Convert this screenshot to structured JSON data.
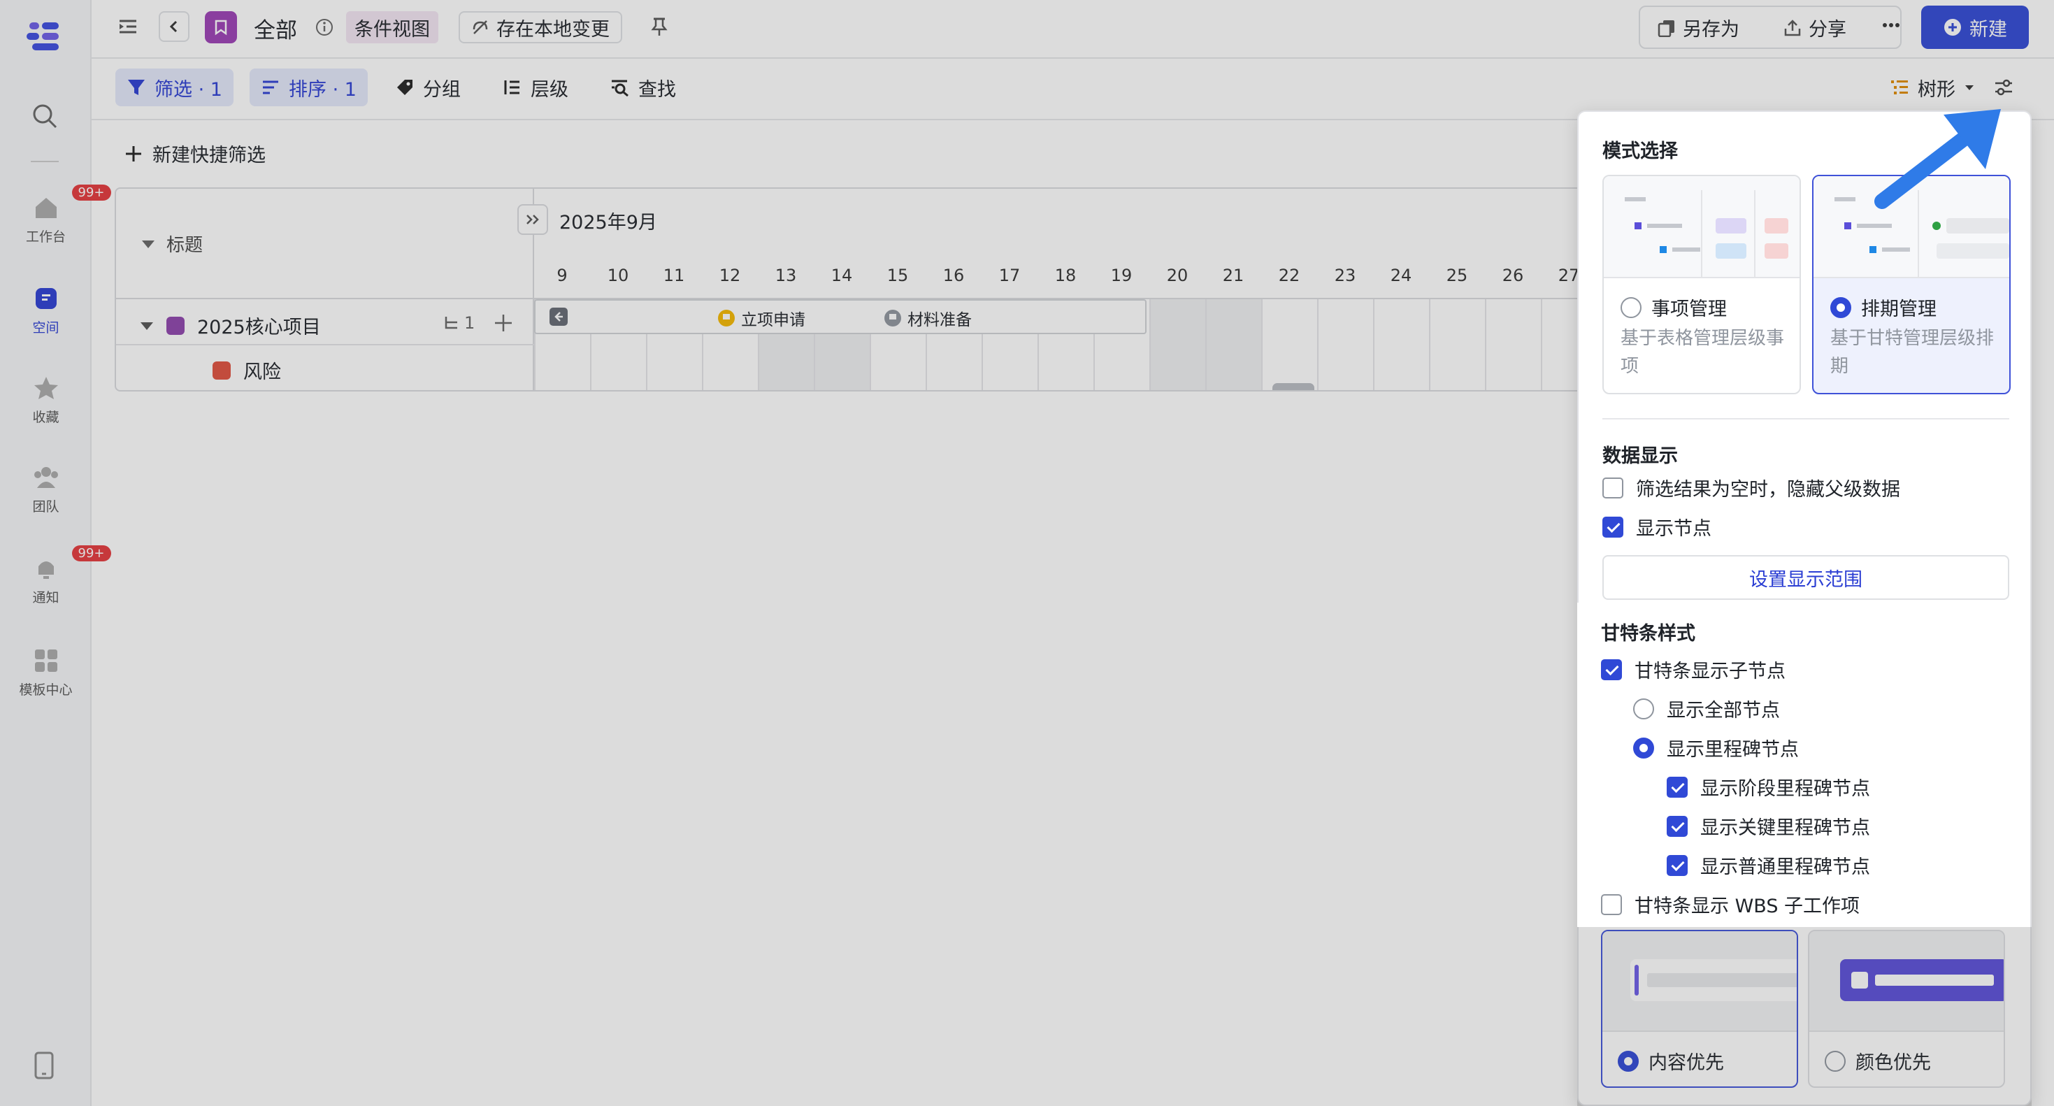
{
  "sidebar": {
    "items": [
      {
        "label": "工作台",
        "icon": "home-icon",
        "badge": "99+"
      },
      {
        "label": "空间",
        "icon": "space-icon",
        "active": true
      },
      {
        "label": "收藏",
        "icon": "star-icon"
      },
      {
        "label": "团队",
        "icon": "team-icon"
      },
      {
        "label": "通知",
        "icon": "bell-icon",
        "badge": "99+"
      },
      {
        "label": "模板中心",
        "icon": "template-icon"
      }
    ]
  },
  "topbar": {
    "title": "全部",
    "view_tag": "条件视图",
    "save_local": "存在本地变更",
    "save_as": "另存为",
    "share": "分享",
    "new_button": "新建"
  },
  "toolbar": {
    "filter": "筛选 · 1",
    "sort": "排序 · 1",
    "group": "分组",
    "level": "层级",
    "find": "查找",
    "view_mode": "树形"
  },
  "quick_filter": "新建快捷筛选",
  "gantt": {
    "title_header": "标题",
    "month": "2025年9月",
    "days": [
      "9",
      "10",
      "11",
      "12",
      "13",
      "14",
      "15",
      "16",
      "17",
      "18",
      "19",
      "20",
      "21",
      "22",
      "23",
      "24",
      "25",
      "26",
      "27"
    ],
    "rows": [
      {
        "name": "2025核心项目",
        "color": "#8e44ad",
        "children_count": "1"
      },
      {
        "name": "风险",
        "color": "#e0503d"
      }
    ],
    "milestones": [
      "立项申请",
      "材料准备"
    ]
  },
  "panel": {
    "mode_title": "模式选择",
    "modes": [
      {
        "title": "事项管理",
        "desc": "基于表格管理层级事项",
        "selected": false
      },
      {
        "title": "排期管理",
        "desc": "基于甘特管理层级排期",
        "selected": true
      }
    ],
    "data_title": "数据显示",
    "hide_parent": "筛选结果为空时，隐藏父级数据",
    "show_nodes": "显示节点",
    "set_range": "设置显示范围",
    "gantt_style_title": "甘特条样式",
    "show_child_nodes": "甘特条显示子节点",
    "show_all_nodes": "显示全部节点",
    "show_milestone_nodes": "显示里程碑节点",
    "show_stage": "显示阶段里程碑节点",
    "show_key": "显示关键里程碑节点",
    "show_normal": "显示普通里程碑节点",
    "show_wbs": "甘特条显示 WBS 子工作项",
    "styles": [
      {
        "title": "内容优先",
        "selected": true
      },
      {
        "title": "颜色优先",
        "selected": false
      }
    ]
  },
  "colors": {
    "accent": "#3049d6",
    "arrow": "#2f7be8"
  }
}
